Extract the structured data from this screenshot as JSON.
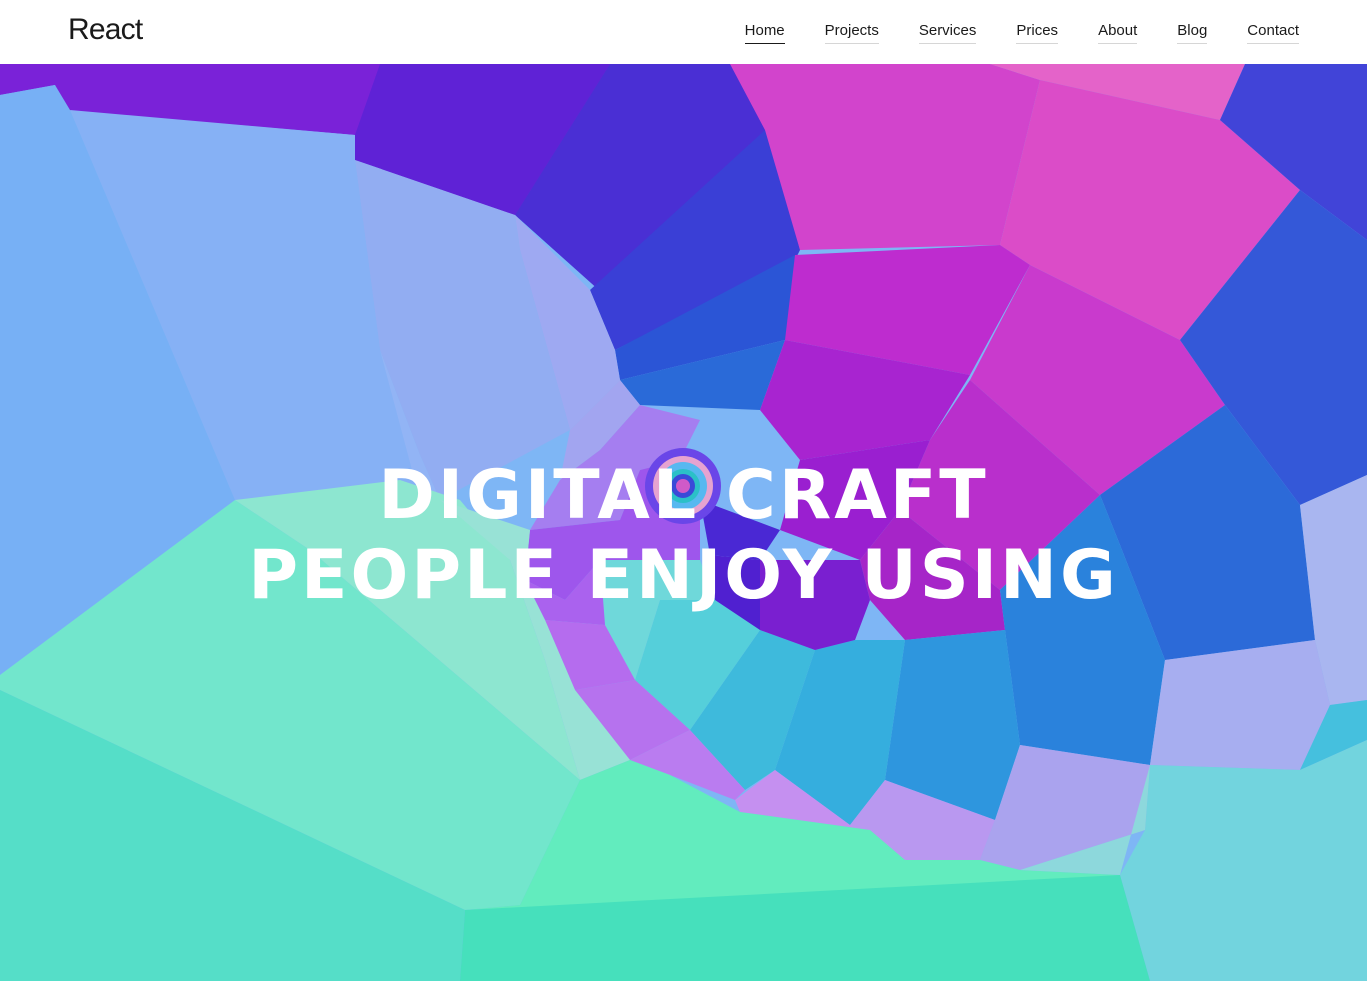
{
  "brand": {
    "name": "React"
  },
  "nav": {
    "items": [
      {
        "label": "Home",
        "active": true
      },
      {
        "label": "Projects"
      },
      {
        "label": "Services"
      },
      {
        "label": "Prices"
      },
      {
        "label": "About"
      },
      {
        "label": "Blog"
      },
      {
        "label": "Contact"
      }
    ]
  },
  "hero": {
    "line1": "DIGITAL CRAFT",
    "line2": "PEOPLE ENJOY USING"
  }
}
